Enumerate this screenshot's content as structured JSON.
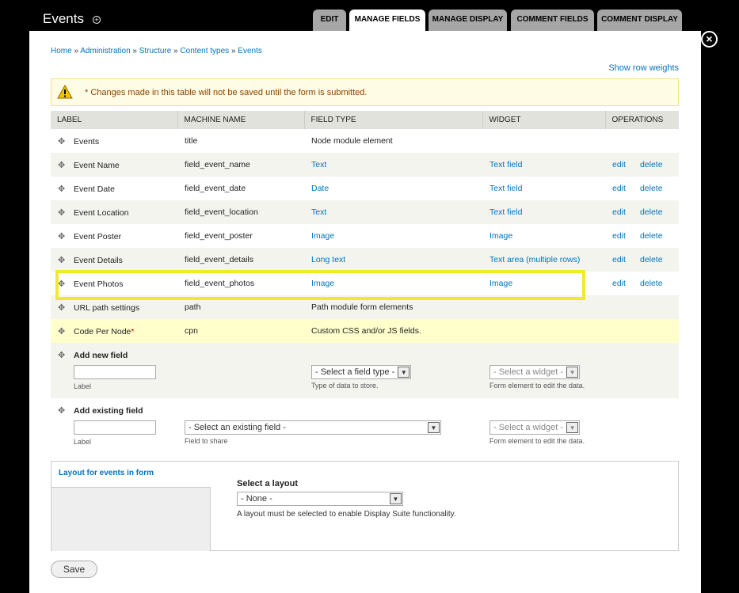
{
  "page": {
    "title": "Events"
  },
  "tabs": [
    "EDIT",
    "MANAGE FIELDS",
    "MANAGE DISPLAY",
    "COMMENT FIELDS",
    "COMMENT DISPLAY"
  ],
  "active_tab": "MANAGE FIELDS",
  "breadcrumb": [
    "Home",
    "Administration",
    "Structure",
    "Content types",
    "Events"
  ],
  "breadcrumb_separator": "»",
  "show_row_weights": "Show row weights",
  "warning": {
    "text": "* Changes made in this table will not be saved until the form is submitted.",
    "color": "#fffce5"
  },
  "table": {
    "headers": [
      "LABEL",
      "MACHINE NAME",
      "FIELD TYPE",
      "WIDGET",
      "OPERATIONS"
    ],
    "rows": [
      {
        "label": "Events",
        "machine": "title",
        "type": "Node module element",
        "widget": "",
        "edit": "",
        "del": ""
      },
      {
        "label": "Event Name",
        "machine": "field_event_name",
        "type": "Text",
        "widget": "Text field",
        "edit": "edit",
        "del": "delete"
      },
      {
        "label": "Event Date",
        "machine": "field_event_date",
        "type": "Date",
        "widget": "Text field",
        "edit": "edit",
        "del": "delete"
      },
      {
        "label": "Event Location",
        "machine": "field_event_location",
        "type": "Text",
        "widget": "Text field",
        "edit": "edit",
        "del": "delete"
      },
      {
        "label": "Event Poster",
        "machine": "field_event_poster",
        "type": "Image",
        "widget": "Image",
        "edit": "edit",
        "del": "delete"
      },
      {
        "label": "Event Details",
        "machine": "field_event_details",
        "type": "Long text",
        "widget": "Text area (multiple rows)",
        "edit": "edit",
        "del": "delete"
      },
      {
        "label": "Event Photos",
        "machine": "field_event_photos",
        "type": "Image",
        "widget": "Image",
        "edit": "edit",
        "del": "delete"
      },
      {
        "label": "URL path settings",
        "machine": "path",
        "type": "Path module form elements",
        "widget": "",
        "edit": "",
        "del": ""
      },
      {
        "label": "Code Per Node",
        "machine": "cpn",
        "type": "Custom CSS and/or JS fields.",
        "widget": "",
        "edit": "",
        "del": ""
      }
    ],
    "code_per_node_marker": "*"
  },
  "add_new": {
    "title": "Add new field",
    "label_desc": "Label",
    "type_select": "- Select a field type -",
    "type_desc": "Type of data to store.",
    "widget_select": "- Select a widget -",
    "widget_desc": "Form element to edit the data."
  },
  "add_existing": {
    "title": "Add existing field",
    "label_desc": "Label",
    "field_select": "- Select an existing field -",
    "field_desc": "Field to share",
    "widget_select": "- Select a widget -",
    "widget_desc": "Form element to edit the data."
  },
  "layout": {
    "legend": "Layout for events in form",
    "select_label": "Select a layout",
    "select_value": "- None -",
    "description": "A layout must be selected to enable Display Suite functionality."
  },
  "save_label": "Save",
  "colors": {
    "link": "#0074bd",
    "highlight": "#f0ea2a",
    "warning_row": "#ffffcc"
  },
  "icons": [
    "shortcut-add-icon",
    "close-icon",
    "warning-icon",
    "drag-handle-icon",
    "chevron-down-icon"
  ]
}
